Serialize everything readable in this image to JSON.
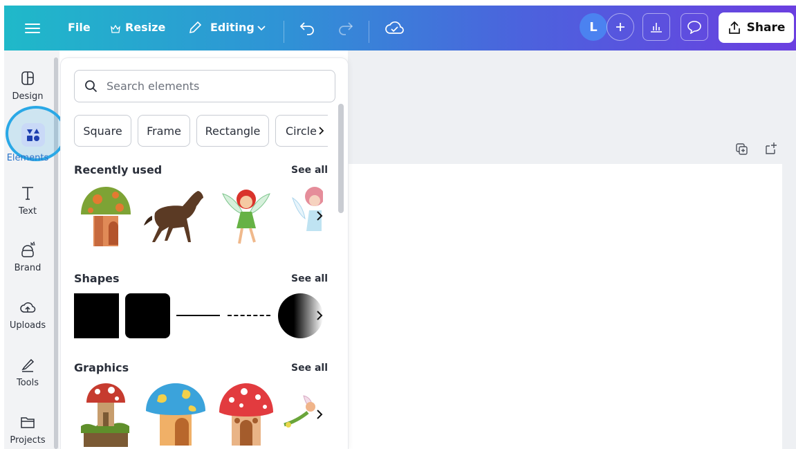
{
  "topbar": {
    "file_label": "File",
    "resize_label": "Resize",
    "editing_label": "Editing",
    "avatar_initial": "L",
    "share_label": "Share",
    "icons": [
      "menu-icon",
      "crown-icon",
      "pencil-icon",
      "chevron-down-icon",
      "undo-icon",
      "redo-icon",
      "cloud-check-icon",
      "plus-icon",
      "analytics-icon",
      "comment-icon",
      "share-upload-icon"
    ],
    "gradient": [
      "#1fb9c9",
      "#2f93d6",
      "#4b63dd",
      "#6b3fe0"
    ]
  },
  "sidebar": {
    "items": [
      {
        "label": "Design",
        "icon": "design-layout-icon"
      },
      {
        "label": "Elements",
        "icon": "elements-shapes-icon",
        "active": true
      },
      {
        "label": "Text",
        "icon": "text-t-icon"
      },
      {
        "label": "Brand",
        "icon": "brand-kit-icon"
      },
      {
        "label": "Uploads",
        "icon": "cloud-upload-icon"
      },
      {
        "label": "Tools",
        "icon": "pen-tools-icon"
      },
      {
        "label": "Projects",
        "icon": "folder-icon"
      }
    ],
    "highlight_color": "#2aa8e6"
  },
  "elements_panel": {
    "search_placeholder": "Search elements",
    "chips": [
      "Square",
      "Frame",
      "Rectangle",
      "Circle"
    ],
    "sections": {
      "recent": {
        "title": "Recently used",
        "see_all": "See all",
        "items": [
          "mushroom-house-green",
          "brown-horse",
          "red-hair-fairy",
          "pink-fairy"
        ]
      },
      "shapes": {
        "title": "Shapes",
        "see_all": "See all",
        "items": [
          "square",
          "rounded-square",
          "solid-line",
          "dashed-line",
          "gradient-circle"
        ]
      },
      "graphics": {
        "title": "Graphics",
        "see_all": "See all",
        "items": [
          "mushroom-house-stump",
          "blue-mushroom-house",
          "red-mushroom-house",
          "flying-fairy"
        ]
      }
    }
  }
}
